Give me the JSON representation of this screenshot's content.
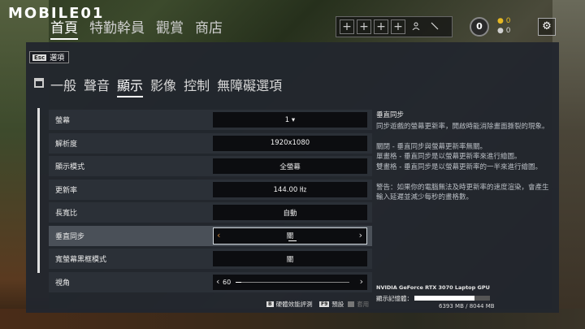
{
  "brand": {
    "logo_text": "MOBILE01"
  },
  "nav": {
    "items": [
      "首頁",
      "特勤幹員",
      "觀賞",
      "商店"
    ],
    "active_index": 0
  },
  "squad": {
    "slot_glyph": "+",
    "slots": 4,
    "player_icon": "person-icon",
    "sword_icon": "sword-icon"
  },
  "renown": {
    "value": "0"
  },
  "currency": {
    "gold": "0",
    "silver": "0"
  },
  "settings_icon": "gear-icon",
  "back": {
    "key": "Esc",
    "label": "選項"
  },
  "tabs": {
    "items": [
      "一般",
      "聲音",
      "顯示",
      "影像",
      "控制",
      "無障礙選項"
    ],
    "active_index": 2
  },
  "settings": {
    "rows": [
      {
        "label": "螢幕",
        "value": "1 ▾"
      },
      {
        "label": "解析度",
        "value": "1920x1080"
      },
      {
        "label": "顯示模式",
        "value": "全螢幕"
      },
      {
        "label": "更新率",
        "value": "144.00 ㎐"
      },
      {
        "label": "長寬比",
        "value": "自動"
      },
      {
        "label": "垂直同步",
        "value": "關"
      },
      {
        "label": "寬螢幕黑框模式",
        "value": "關"
      },
      {
        "label": "視角",
        "value": "60",
        "slider_fraction": 0.05
      }
    ],
    "highlighted_index": 5
  },
  "description": {
    "title": "垂直同步",
    "paragraphs": [
      "同步遊戲的螢幕更新率，開啟時能消除畫面撕裂的現象。",
      "關閉 - 垂直同步與螢幕更新率無關。\n單畫格 - 垂直同步是以螢幕更新率來進行繪圖。\n雙畫格 - 垂直同步是以螢幕更新率的一半來進行繪圖。",
      "警告：如果你的電腦無法及時更新率的速度渲染，會產生輸入延遲並減少每秒的畫格數。"
    ]
  },
  "gpu": {
    "name": "NVIDIA GeForce RTX 3070 Laptop GPU",
    "vram_label": "顯示記憶體：",
    "vram_text": "6393 MB / 8044 MB",
    "vram_fraction": 0.795
  },
  "footer": {
    "benchmark": {
      "key": "B",
      "label": "硬體效能評測"
    },
    "default": {
      "key": "F9",
      "label": "預設"
    },
    "apply": {
      "key": "",
      "label": "套用"
    }
  }
}
